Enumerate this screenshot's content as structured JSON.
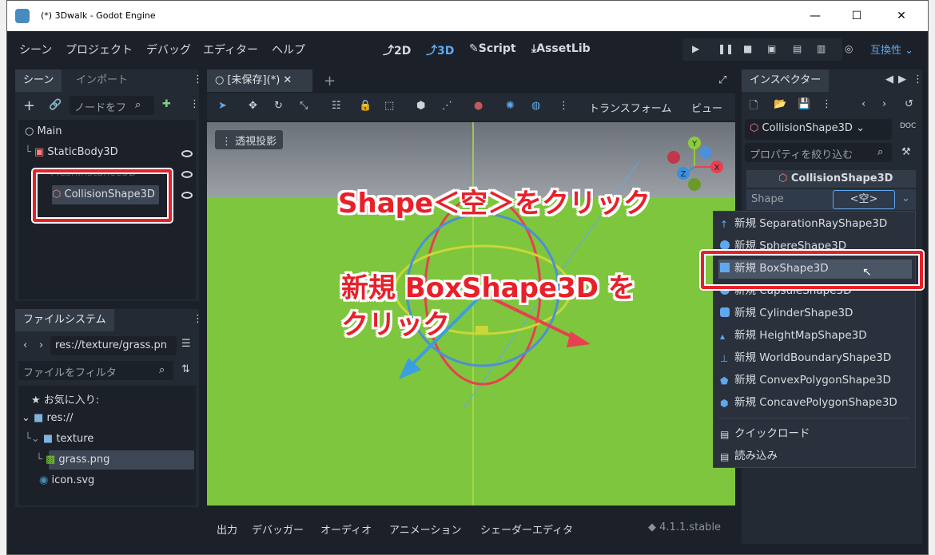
{
  "window": {
    "title": "(*) 3Dwalk - Godot Engine",
    "controls": [
      "—",
      "☐",
      "✕"
    ]
  },
  "menu": [
    "シーン",
    "プロジェクト",
    "デバッグ",
    "エディター",
    "ヘルプ"
  ],
  "workspaces": [
    "2D",
    "3D",
    "Script",
    "AssetLib"
  ],
  "renderer": "互換性",
  "scene_panel": {
    "tabs": [
      "シーン",
      "インポート"
    ],
    "filter_placeholder": "ノードをフ",
    "nodes": [
      "Main",
      "StaticBody3D",
      "MeshInstance3D",
      "CollisionShape3D"
    ]
  },
  "filesystem": {
    "tab": "ファイルシステム",
    "path": "res://texture/grass.pn",
    "filter_placeholder": "ファイルをフィルタ",
    "items": [
      "お気に入り:",
      "res://",
      "texture",
      "grass.png",
      "icon.svg"
    ]
  },
  "editor": {
    "tab_label": "[未保存](*)",
    "toolbar_transform": "トランスフォーム",
    "toolbar_view": "ビュー",
    "perspective_label": "透視投影",
    "gizmo_axes": [
      "Y",
      "Z",
      "X"
    ]
  },
  "annotations": {
    "line1": "Shape＜空＞をクリック",
    "line2": "新規 BoxShape3D を",
    "line3": "クリック"
  },
  "bottom_panel": {
    "tabs": [
      "出力",
      "デバッガー",
      "オーディオ",
      "アニメーション",
      "シェーダーエディタ"
    ],
    "version": "4.1.1.stable"
  },
  "inspector": {
    "tab": "インスペクター",
    "node_type": "CollisionShape3D",
    "filter_placeholder": "プロパティを絞り込む",
    "section_title": "CollisionShape3D",
    "property_name": "Shape",
    "property_value": "<空>",
    "doc_label": "DOC"
  },
  "shape_menu": {
    "items": [
      "新規 SeparationRayShape3D",
      "新規 SphereShape3D",
      "新規 BoxShape3D",
      "新規 CapsuleShape3D",
      "新規 CylinderShape3D",
      "新規 HeightMapShape3D",
      "新規 WorldBoundaryShape3D",
      "新規 ConvexPolygonShape3D",
      "新規 ConcavePolygonShape3D"
    ],
    "quick_load": "クイックロード",
    "load": "読み込み"
  },
  "colors": {
    "accent": "#5fa8f0",
    "annotation_red": "#e8202a",
    "ground": "#7ec63d"
  }
}
